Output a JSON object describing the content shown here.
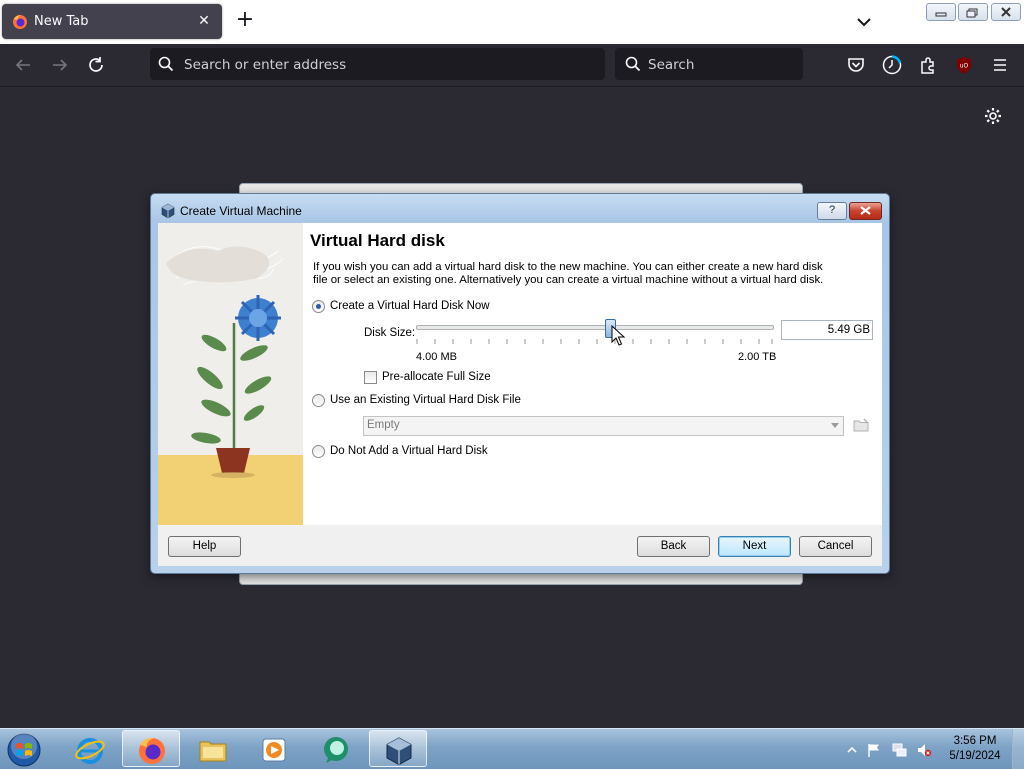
{
  "browser": {
    "tab_title": "New Tab",
    "address_placeholder": "Search or enter address",
    "search_placeholder": "Search"
  },
  "dialog": {
    "window_title": "Create Virtual Machine",
    "help_glyph": "?",
    "heading": "Virtual Hard disk",
    "description": "If you wish you can add a virtual hard disk to the new machine. You can either create a new hard disk file or select an existing one. Alternatively you can create a virtual machine without a virtual hard disk.",
    "option_create_now": "Create a Virtual Hard Disk Now",
    "option_create_now_checked": true,
    "disk_size_label": "Disk Size:",
    "disk_size_value": "5.49 GB",
    "slider_min_label": "4.00 MB",
    "slider_max_label": "2.00 TB",
    "preallocate_label": "Pre-allocate Full Size",
    "preallocate_checked": false,
    "option_use_existing": "Use an Existing Virtual Hard Disk File",
    "existing_file_value": "Empty",
    "option_no_disk": "Do Not Add a Virtual Hard Disk",
    "buttons": {
      "help": "Help",
      "back": "Back",
      "next": "Next",
      "cancel": "Cancel"
    }
  },
  "taskbar": {
    "pinned": [
      "start-orb",
      "internet-explorer-icon",
      "firefox-icon",
      "file-explorer-icon",
      "media-player-icon",
      "chat-app-icon",
      "virtualbox-icon"
    ],
    "clock_time": "3:56 PM",
    "clock_date": "5/19/2024"
  },
  "colors": {
    "browser_bg": "#2b2a33",
    "accent": "#3c7fb1",
    "taskbar": "#7ea3c6"
  }
}
